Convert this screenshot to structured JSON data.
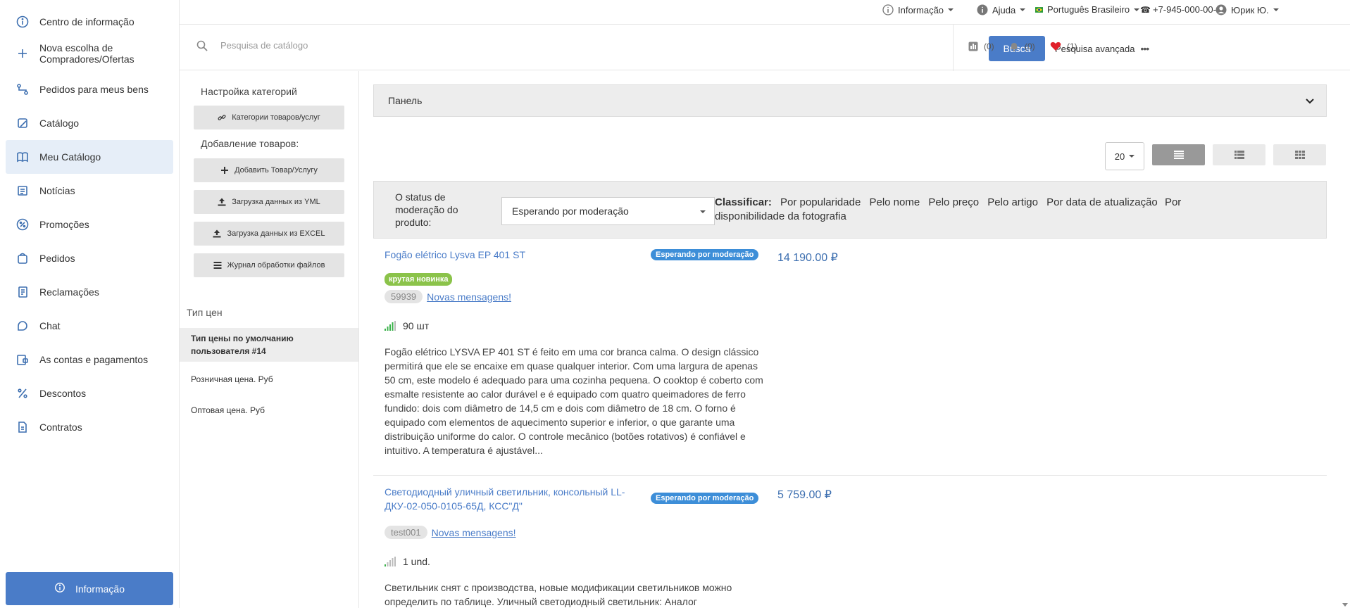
{
  "nav": {
    "items": [
      {
        "label": "Centro de informação",
        "icon": "info-icon"
      },
      {
        "label": "Nova escolha de Compradores/Ofertas",
        "icon": "plus-icon"
      },
      {
        "label": "Pedidos para meus bens",
        "icon": "route-icon"
      },
      {
        "label": "Catálogo",
        "icon": "catalog-icon"
      },
      {
        "label": "Meu Catálogo",
        "icon": "book-icon"
      },
      {
        "label": "Notícias",
        "icon": "news-icon"
      },
      {
        "label": "Promoções",
        "icon": "percent-circle-icon"
      },
      {
        "label": "Pedidos",
        "icon": "bag-icon"
      },
      {
        "label": "Reclamações",
        "icon": "complaint-icon"
      },
      {
        "label": "Chat",
        "icon": "chat-icon"
      },
      {
        "label": "As contas e pagamentos",
        "icon": "bill-icon"
      },
      {
        "label": "Descontos",
        "icon": "percent-icon"
      },
      {
        "label": "Contratos",
        "icon": "document-icon"
      }
    ],
    "bottom_label": "Informação"
  },
  "topbar": {
    "info": "Informação",
    "help": "Ajuda",
    "language": "Português Brasileiro",
    "phone": "+7-945-000-00-00",
    "user": "Юрик Ю."
  },
  "search": {
    "placeholder": "Pesquisa de catálogo",
    "button": "Busca",
    "advanced": "Pesquisa avançada",
    "compare_count": "(0)",
    "notify_count": "(0)",
    "favorites_count": "(1)"
  },
  "side": {
    "category_heading": "Настройка категорий",
    "categories_button": "Категории товаров/услуг",
    "add_heading": "Добавление товаров:",
    "add_button": "Добавить Товар/Услугу",
    "yml_button": "Загрузка данных из YML",
    "excel_button": "Загрузка данных из EXCEL",
    "log_button": "Журнал обработки файлов",
    "price_types_heading": "Тип цен",
    "price_types": [
      "Тип цены по умолчанию пользователя #14",
      "Розничная цена. Руб",
      "Оптовая цена. Руб"
    ]
  },
  "main": {
    "panel_label": "Панель",
    "per_page": "20",
    "filter_label": "O status de moderação do produto:",
    "filter_value": "Esperando por moderação",
    "sort_label": "Classificar:",
    "sort_options": [
      "Por popularidade",
      "Pelo nome",
      "Pelo preço",
      "Pelo artigo",
      "Por data de atualização",
      "Por disponibilidade da fotografia"
    ],
    "products": [
      {
        "title": "Fogão elétrico Lysva EP 401 ST",
        "status": "Esperando por moderação",
        "price": "14 190.00 ₽",
        "tag": "крутая новинка",
        "sku": "59939",
        "messages": "Novas mensagens!",
        "stock": "90 шт",
        "description": "Fogão elétrico LYSVA EP 401 ST é feito em uma cor branca calma. O design clássico permitirá que ele se encaixe em quase qualquer interior. Com uma largura de apenas 50 cm, este modelo é adequado para uma cozinha pequena. O cooktop é coberto com esmalte resistente ao calor durável e é equipado com quatro queimadores de ferro fundido: dois com diâmetro de 14,5 cm e dois com diâmetro de 18 cm. O forno é equipado com elementos de aquecimento superior e inferior, o que garante uma distribuição uniforme do calor. O controle mecânico (botões rotativos) é confiável e intuitivo. A temperatura é ajustável..."
      },
      {
        "title": "Светодиодный уличный светильник, консольный LL-ДКУ-02-050-0105-65Д, КСС\"Д\"",
        "status": "Esperando por moderação",
        "price": "5 759.00 ₽",
        "sku": "test001",
        "messages": "Novas mensagens!",
        "stock": "1 und.",
        "description": "Светильник снят с производства, новые модификации светильников можно определить по таблице. Уличный светодиодный светильник: Аналог"
      }
    ]
  },
  "colors": {
    "accent": "#4a7cc8",
    "badge": "#3d8ed8",
    "new_tag": "#8bc34a",
    "favorite": "#e0202a"
  }
}
